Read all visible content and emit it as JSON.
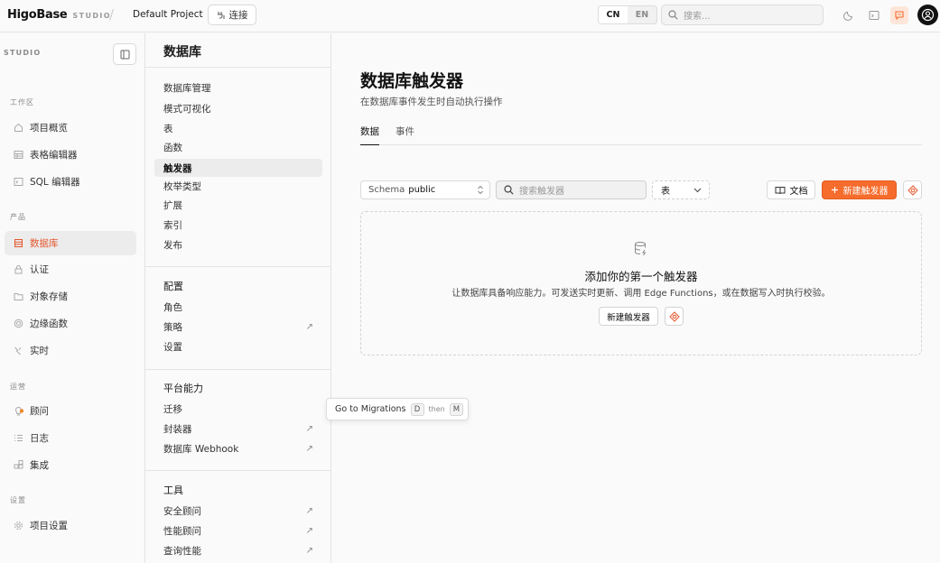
{
  "topbar": {
    "logo": "HigoBase",
    "studio_tag": "STUDIO",
    "separator": "/",
    "project": "Default Project",
    "connect_label": "连接",
    "lang": [
      "CN",
      "EN"
    ],
    "lang_selected": "CN",
    "search_placeholder": "搜索..."
  },
  "sidebar": {
    "header": "STUDIO",
    "sections": {
      "workspace": "工作区",
      "product": "产品",
      "ops": "运营",
      "settings": "设置"
    },
    "items": {
      "overview": "项目概览",
      "table_editor": "表格编辑器",
      "sql_editor": "SQL 编辑器",
      "database": "数据库",
      "auth": "认证",
      "storage": "对象存储",
      "edge_functions": "边缘函数",
      "realtime": "实时",
      "advisor": "顾问",
      "logs": "日志",
      "integrations": "集成",
      "project_settings": "项目设置"
    }
  },
  "subnav": {
    "title": "数据库",
    "group1": [
      "数据库管理",
      "模式可视化",
      "表",
      "函数",
      "触发器",
      "枚举类型",
      "扩展",
      "索引",
      "发布"
    ],
    "group2_head": "配置",
    "group2": [
      "角色",
      "策略",
      "设置"
    ],
    "group3_head": "平台能力",
    "group3": [
      "迁移",
      "封装器",
      "数据库 Webhook"
    ],
    "group4_head": "工具",
    "group4": [
      "安全顾问",
      "性能顾问",
      "查询性能"
    ],
    "arrow": "↗"
  },
  "main": {
    "title": "数据库触发器",
    "subtitle": "在数据库事件发生时自动执行操作",
    "tabs": [
      "数据",
      "事件"
    ],
    "schema_label": "Schema",
    "schema_value": "public",
    "search_placeholder": "搜索触发器",
    "table_filter": "表",
    "docs_label": "文档",
    "new_label": "新建触发器",
    "empty_title": "添加你的第一个触发器",
    "empty_desc": "让数据库具备响应能力。可发送实时更新、调用 Edge Functions，或在数据写入时执行校验。",
    "empty_button": "新建触发器"
  },
  "tooltip": {
    "text": "Go to Migrations",
    "key1": "D",
    "then": "then",
    "key2": "M"
  },
  "colors": {
    "accent": "#f56c2d",
    "active_text": "#e4572e"
  }
}
